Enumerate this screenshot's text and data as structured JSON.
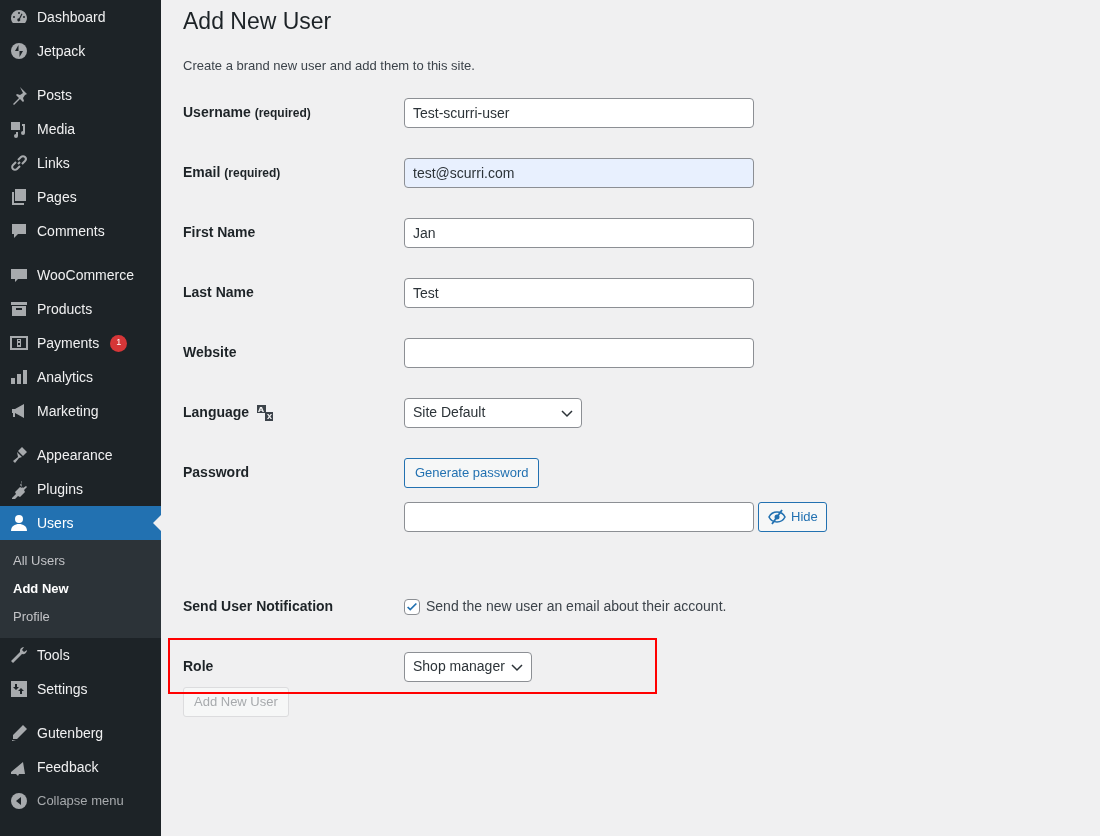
{
  "sidebar": {
    "groups": [
      {
        "items": [
          {
            "label": "Dashboard",
            "selected": false
          },
          {
            "label": "Jetpack",
            "selected": false
          }
        ]
      },
      {
        "items": [
          {
            "label": "Posts",
            "selected": false
          },
          {
            "label": "Media",
            "selected": false
          },
          {
            "label": "Links",
            "selected": false
          },
          {
            "label": "Pages",
            "selected": false
          },
          {
            "label": "Comments",
            "selected": false
          }
        ]
      },
      {
        "items": [
          {
            "label": "WooCommerce",
            "selected": false
          },
          {
            "label": "Products",
            "selected": false
          },
          {
            "label": "Payments",
            "selected": false,
            "badge": "1"
          },
          {
            "label": "Analytics",
            "selected": false
          },
          {
            "label": "Marketing",
            "selected": false
          }
        ]
      },
      {
        "items": [
          {
            "label": "Appearance",
            "selected": false
          },
          {
            "label": "Plugins",
            "selected": false
          },
          {
            "label": "Users",
            "selected": true,
            "children": [
              {
                "label": "All Users",
                "selected": false
              },
              {
                "label": "Add New",
                "selected": true
              },
              {
                "label": "Profile",
                "selected": false
              }
            ]
          },
          {
            "label": "Tools",
            "selected": false
          },
          {
            "label": "Settings",
            "selected": false
          }
        ]
      },
      {
        "items": [
          {
            "label": "Gutenberg",
            "selected": false
          },
          {
            "label": "Feedback",
            "selected": false
          }
        ]
      }
    ],
    "collapse": "Collapse menu"
  },
  "page": {
    "title": "Add New User",
    "description": "Create a brand new user and add them to this site."
  },
  "form": {
    "rows": [
      {
        "kind": "text",
        "label": "Username",
        "note": "(required)",
        "value": "Test-scurri-user",
        "autofilled": false,
        "highlighted": false
      },
      {
        "kind": "text",
        "label": "Email",
        "note": "(required)",
        "value": "test@scurri.com",
        "autofilled": true,
        "highlighted": false
      },
      {
        "kind": "text",
        "label": "First Name",
        "value": "Jan",
        "autofilled": false,
        "highlighted": false
      },
      {
        "kind": "text",
        "label": "Last Name",
        "value": "Test",
        "autofilled": false,
        "highlighted": false
      },
      {
        "kind": "text",
        "label": "Website",
        "autofilled": false,
        "highlighted": false
      },
      {
        "kind": "select",
        "label": "Language",
        "value": "Site Default",
        "wide": true,
        "highlighted": false
      },
      {
        "kind": "password",
        "label": "Password",
        "generate": "Generate password",
        "toggle": "Hide",
        "highlighted": false
      },
      {
        "kind": "checkbox",
        "label": "Send User Notification",
        "text": "Send the new user an email about their account.",
        "checked": true,
        "highlighted": false
      },
      {
        "kind": "select",
        "label": "Role",
        "value": "Shop manager",
        "wide": false,
        "highlighted": true
      }
    ],
    "submit": {
      "label": "Add New User",
      "disabled": true
    }
  }
}
